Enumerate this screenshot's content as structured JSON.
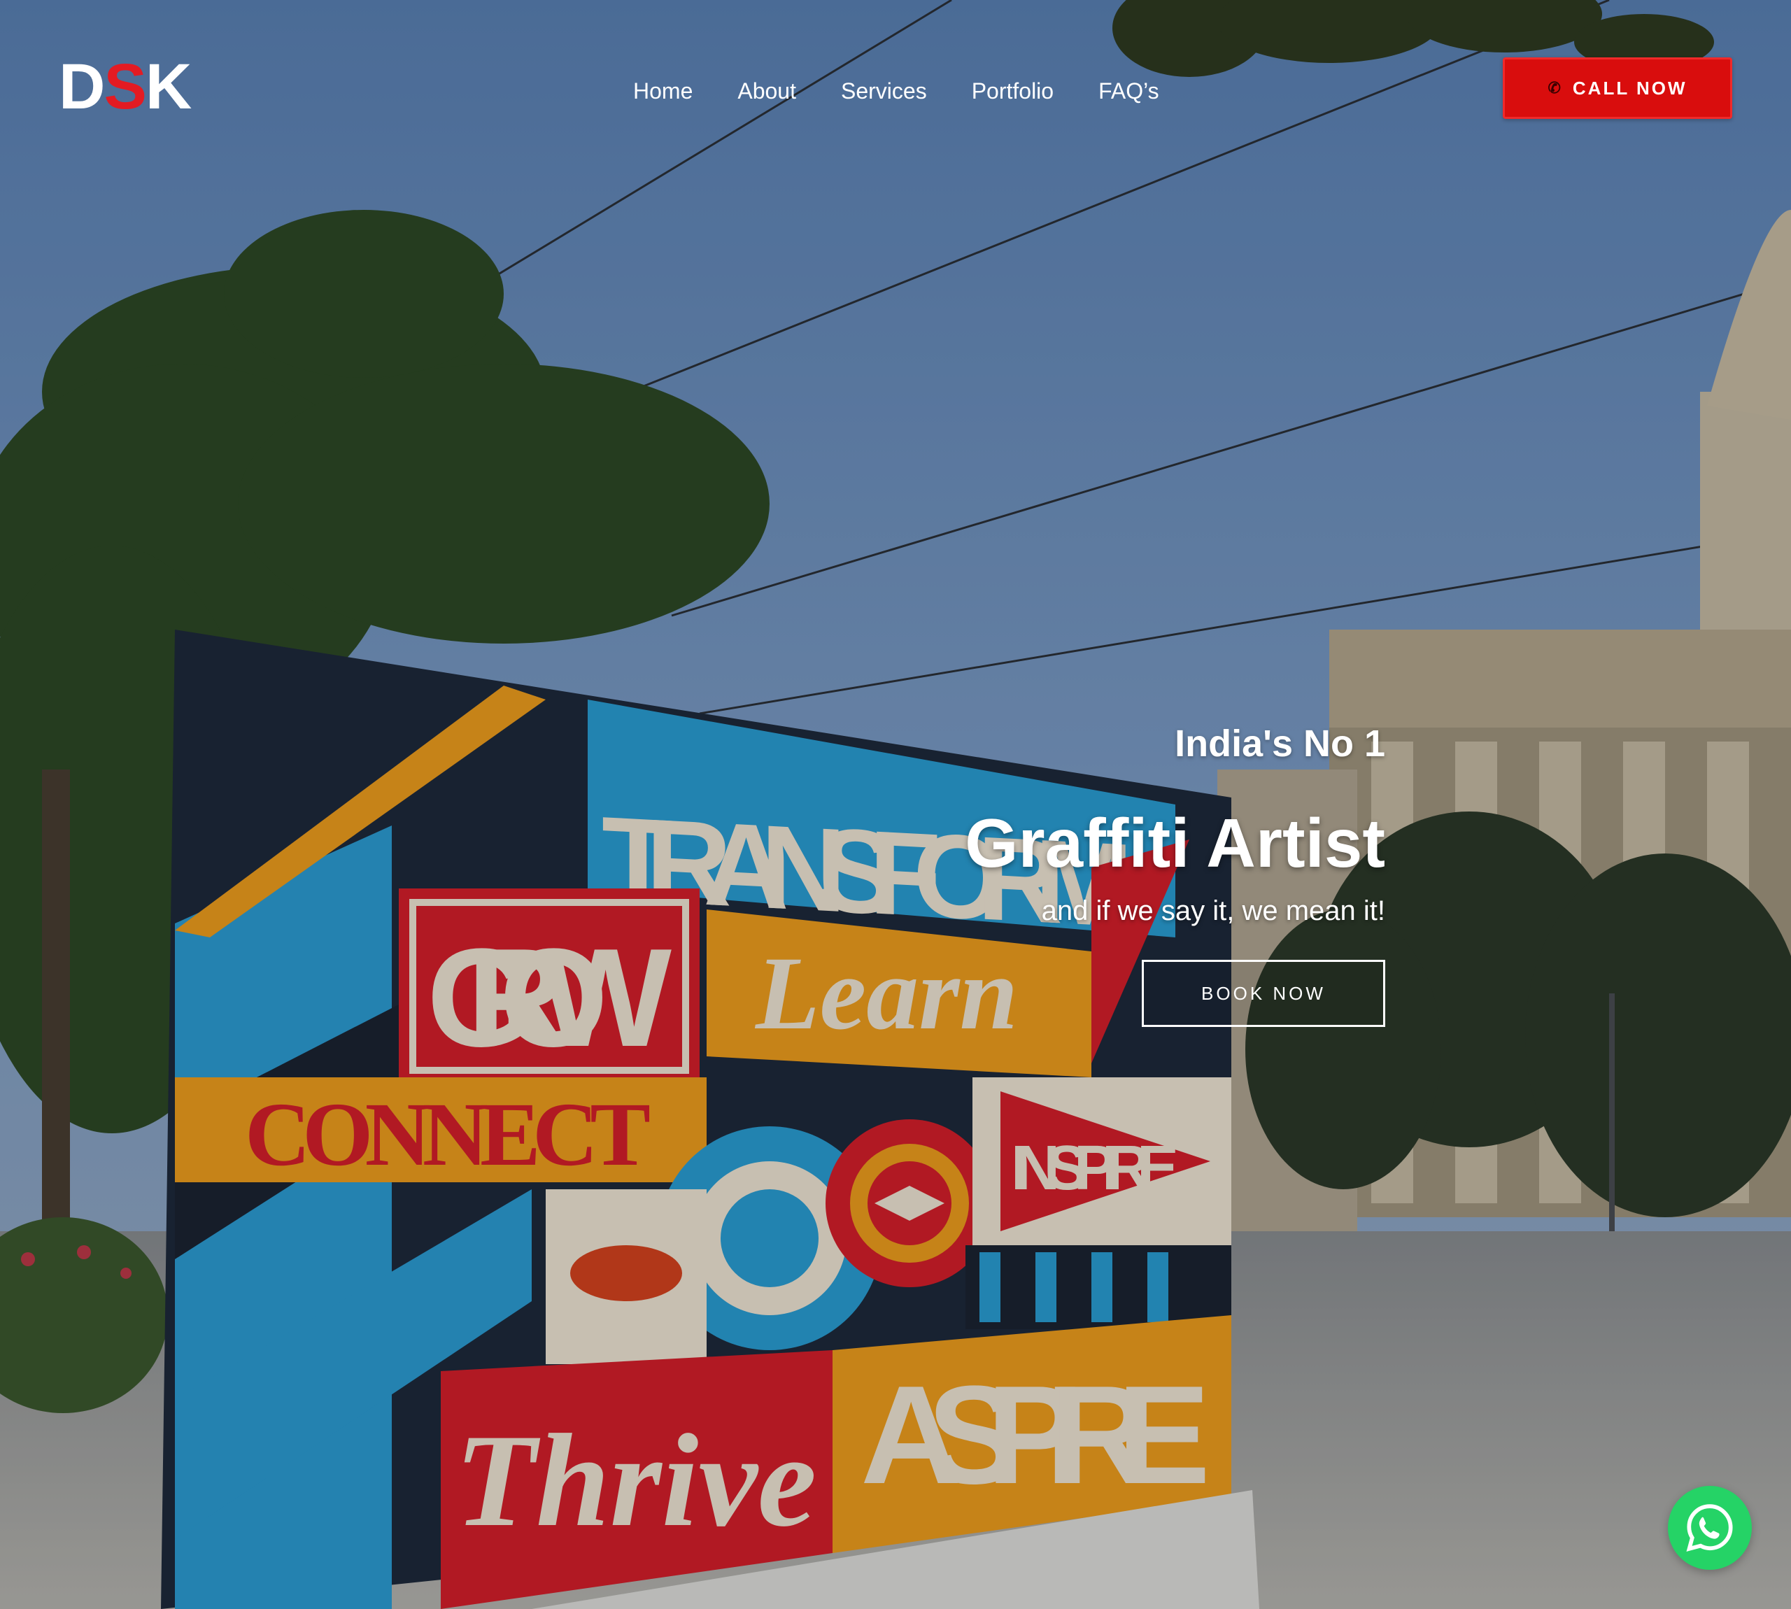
{
  "brand": {
    "logo_prefix": "D",
    "logo_accent": "S",
    "logo_suffix": "K",
    "accent_color": "#e31b23"
  },
  "nav": {
    "items": [
      {
        "label": "Home"
      },
      {
        "label": "About"
      },
      {
        "label": "Services"
      },
      {
        "label": "Portfolio"
      },
      {
        "label": "FAQ’s"
      }
    ]
  },
  "header": {
    "call_label": "CALL NOW",
    "call_icon": "phone-icon",
    "call_color": "#d90d0d"
  },
  "hero": {
    "kicker": "India's No 1",
    "title": "Graffiti Artist",
    "subtitle": "and if we say it, we mean it!",
    "cta_label": "BOOK NOW",
    "mural_words": [
      "TRANSFORM",
      "GROW",
      "Learn",
      "CONNECT",
      "INSPIRE",
      "Thrive",
      "ASPIRE"
    ]
  },
  "floating": {
    "whatsapp_icon": "whatsapp-icon",
    "whatsapp_color": "#25d366"
  }
}
